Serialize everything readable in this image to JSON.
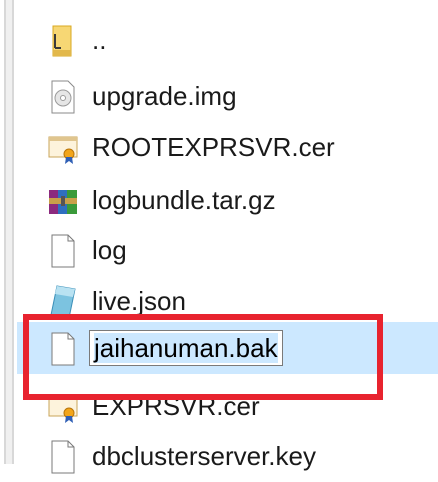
{
  "files": [
    {
      "name": "..",
      "icon": "folder-up-icon"
    },
    {
      "name": "upgrade.img",
      "icon": "disc-image-icon"
    },
    {
      "name": "ROOTEXPRSVR.cer",
      "icon": "certificate-icon"
    },
    {
      "name": "logbundle.tar.gz",
      "icon": "archive-icon"
    },
    {
      "name": "log",
      "icon": "blank-file-icon"
    },
    {
      "name": "live.json",
      "icon": "json-file-icon"
    },
    {
      "name": "jaihanuman.bak",
      "icon": "blank-file-icon",
      "renaming": true
    },
    {
      "name": "EXPRSVR.cer",
      "icon": "certificate-icon"
    },
    {
      "name": "dbclusterserver.key",
      "icon": "blank-file-icon"
    }
  ],
  "colors": {
    "selection": "#cce8ff",
    "highlight": "#e8232f"
  }
}
